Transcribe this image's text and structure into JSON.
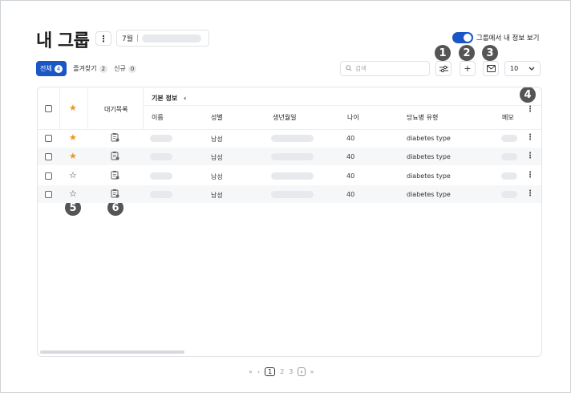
{
  "header": {
    "title": "내 그룹",
    "date_prefix": "7월",
    "toggle_label": "그룹에서 내 정보 보기",
    "toggle_on": true
  },
  "tabs": [
    {
      "label": "전체",
      "count": "4",
      "active": true
    },
    {
      "label": "즐겨찾기",
      "count": "2",
      "active": false
    },
    {
      "label": "신규",
      "count": "0",
      "active": false
    }
  ],
  "toolbar": {
    "search_placeholder": "검색",
    "page_size": "10"
  },
  "callouts": [
    "1",
    "2",
    "3",
    "4",
    "5",
    "6"
  ],
  "table": {
    "col_waitlist": "대기목록",
    "group_header": "기본 정보",
    "columns": [
      "이름",
      "성별",
      "생년월일",
      "나이",
      "당뇨병 유형",
      "메모"
    ],
    "rows": [
      {
        "favorite": true,
        "gender": "남성",
        "age": "40",
        "diabetes_type": "diabetes type"
      },
      {
        "favorite": true,
        "gender": "남성",
        "age": "40",
        "diabetes_type": "diabetes type"
      },
      {
        "favorite": false,
        "gender": "남성",
        "age": "40",
        "diabetes_type": "diabetes type"
      },
      {
        "favorite": false,
        "gender": "남성",
        "age": "40",
        "diabetes_type": "diabetes type"
      }
    ]
  },
  "pagination": {
    "pages": [
      "1",
      "2",
      "3"
    ],
    "current": "1"
  },
  "colors": {
    "accent": "#1a56c4",
    "star": "#f29318",
    "callout": "#555555"
  }
}
